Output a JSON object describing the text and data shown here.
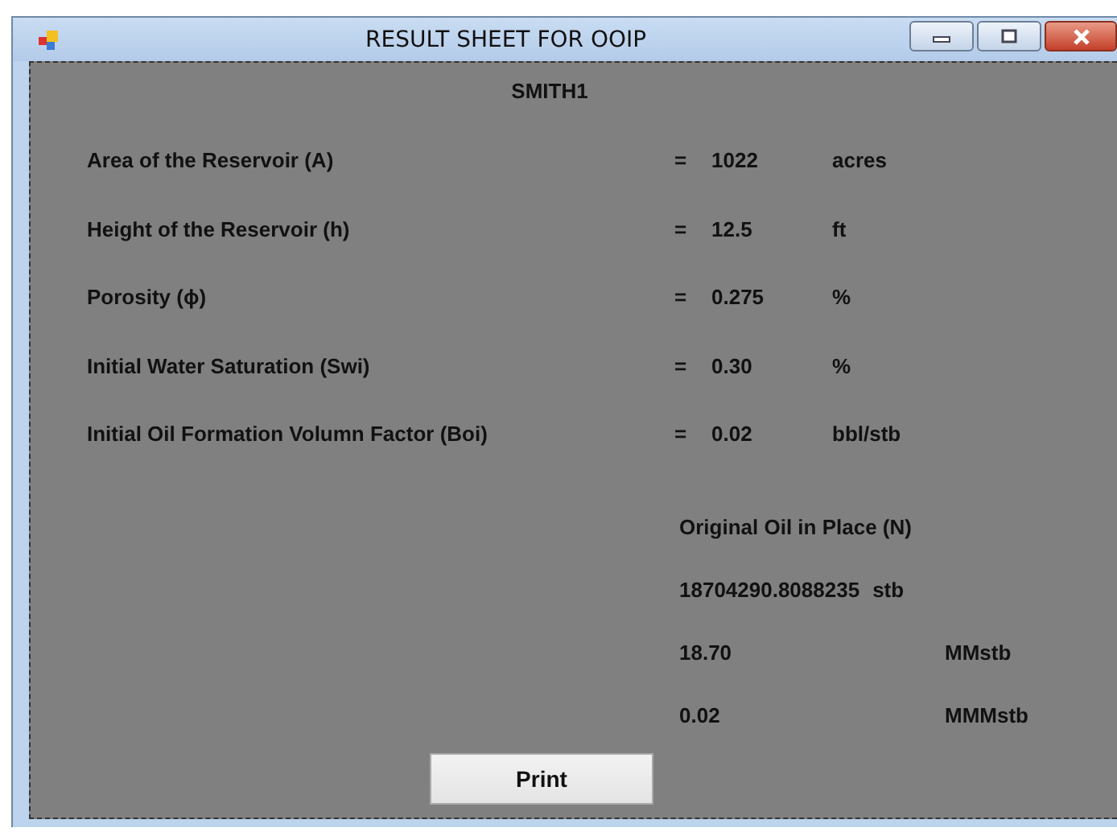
{
  "window": {
    "title": "RESULT SHEET FOR OOIP"
  },
  "heading": "SMITH1",
  "inputs": [
    {
      "label": "Area of the Reservoir (A)",
      "equals": "=",
      "value": "1022",
      "unit": "acres"
    },
    {
      "label": "Height of the Reservoir (h)",
      "equals": "=",
      "value": "12.5",
      "unit": "ft"
    },
    {
      "label": "Porosity (ϕ)",
      "equals": "=",
      "value": "0.275",
      "unit": "%"
    },
    {
      "label": "Initial Water Saturation (Swi)",
      "equals": "=",
      "value": "0.30",
      "unit": "%"
    },
    {
      "label": "Initial Oil Formation Volumn Factor (Boi)",
      "equals": "=",
      "value": "0.02",
      "unit": "bbl/stb"
    }
  ],
  "result": {
    "title": "Original Oil in Place (N)",
    "lines": [
      {
        "value": "18704290.8088235",
        "unit": "stb"
      },
      {
        "value": "18.70",
        "unit": "MMstb"
      },
      {
        "value": "0.02",
        "unit": "MMMstb"
      }
    ]
  },
  "buttons": [
    "Print"
  ]
}
